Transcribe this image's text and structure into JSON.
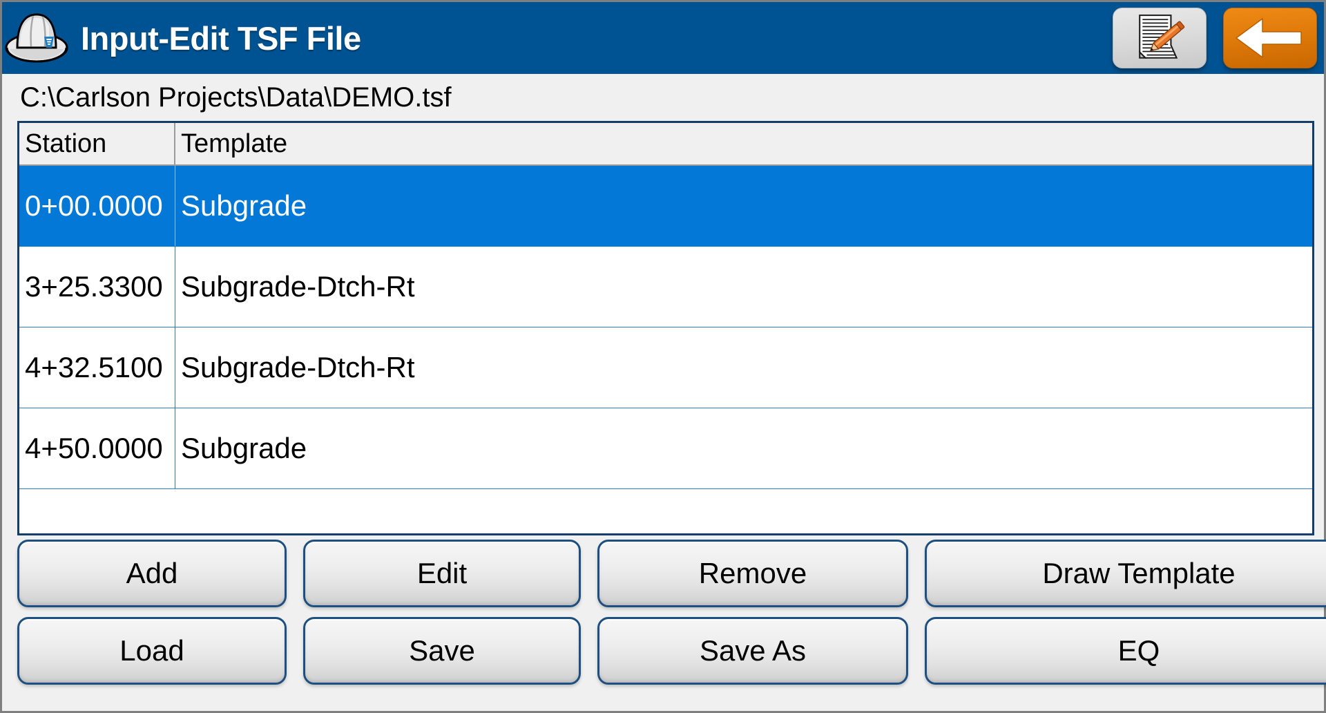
{
  "window": {
    "frame_color": "#808080",
    "body_background": "#f0f0f0"
  },
  "titlebar": {
    "title": "Input-Edit TSF File",
    "background_color": "#005392",
    "title_color": "#ffffff",
    "app_icon": "hard-hat-icon",
    "buttons": [
      {
        "name": "edit-document-button",
        "icon": "document-pencil-icon",
        "style": "gray"
      },
      {
        "name": "back-button",
        "icon": "back-arrow-icon",
        "style": "orange",
        "color": "#e07b0b"
      }
    ]
  },
  "path": {
    "value": "C:\\Carlson Projects\\Data\\DEMO.tsf"
  },
  "table": {
    "border_color": "#143d6b",
    "header_background": "#f0f0f0",
    "selection_color": "#0478d7",
    "grid_line_color": "#2e7cc4",
    "columns": [
      {
        "key": "station",
        "label": "Station"
      },
      {
        "key": "template",
        "label": "Template"
      }
    ],
    "rows": [
      {
        "station": "0+00.0000",
        "template": "Subgrade",
        "selected": true
      },
      {
        "station": "3+25.3300",
        "template": "Subgrade-Dtch-Rt",
        "selected": false
      },
      {
        "station": "4+32.5100",
        "template": "Subgrade-Dtch-Rt",
        "selected": false
      },
      {
        "station": "4+50.0000",
        "template": "Subgrade",
        "selected": false
      }
    ]
  },
  "buttons": [
    {
      "name": "add-button",
      "label": "Add"
    },
    {
      "name": "edit-button",
      "label": "Edit"
    },
    {
      "name": "remove-button",
      "label": "Remove"
    },
    {
      "name": "draw-template-button",
      "label": "Draw Template"
    },
    {
      "name": "load-button",
      "label": "Load"
    },
    {
      "name": "save-button",
      "label": "Save"
    },
    {
      "name": "save-as-button",
      "label": "Save As"
    },
    {
      "name": "eq-button",
      "label": "EQ"
    }
  ]
}
